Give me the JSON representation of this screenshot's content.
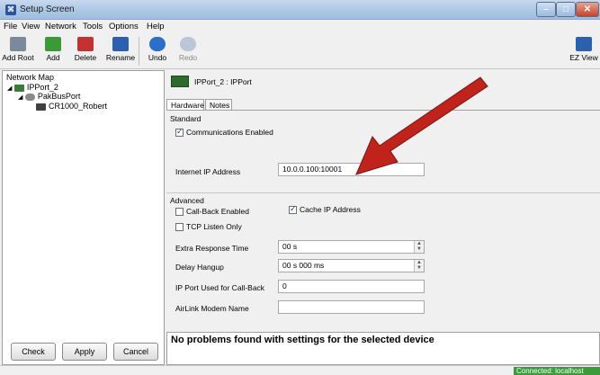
{
  "window": {
    "title": "Setup Screen"
  },
  "menu": [
    {
      "label": "File"
    },
    {
      "label": "View"
    },
    {
      "label": "Network"
    },
    {
      "label": "Tools"
    },
    {
      "label": "Options"
    },
    {
      "label": "Help"
    }
  ],
  "toolbar": {
    "add_root": "Add Root",
    "add": "Add",
    "delete": "Delete",
    "rename": "Rename",
    "undo": "Undo",
    "redo": "Redo",
    "ez_view": "EZ View"
  },
  "network_map": {
    "title": "Network Map",
    "nodes": [
      {
        "label": "IPPort_2"
      },
      {
        "label": "PakBusPort"
      },
      {
        "label": "CR1000_Robert"
      }
    ]
  },
  "left_buttons": {
    "check": "Check",
    "apply": "Apply",
    "cancel": "Cancel"
  },
  "device": {
    "header": "IPPort_2 : IPPort"
  },
  "tabs": [
    {
      "label": "Hardware",
      "active": true
    },
    {
      "label": "Notes",
      "active": false
    }
  ],
  "standard": {
    "section": "Standard",
    "comms_enabled_label": "Communications Enabled",
    "comms_enabled": true,
    "ip_label": "Internet IP Address",
    "ip_value": "10.0.0.100:10001"
  },
  "advanced": {
    "section": "Advanced",
    "callback_label": "Call-Back Enabled",
    "callback": false,
    "cache_ip_label": "Cache IP Address",
    "cache_ip": true,
    "tcp_listen_label": "TCP Listen Only",
    "tcp_listen": false,
    "extra_response_label": "Extra Response Time",
    "extra_response_value": "00 s",
    "delay_hangup_label": "Delay Hangup",
    "delay_hangup_value": "00 s 000 ms",
    "ip_port_callback_label": "IP Port Used for Call-Back",
    "ip_port_callback_value": "0",
    "airlink_label": "AirLink Modem Name",
    "airlink_value": ""
  },
  "message": "No problems found with settings for the selected device",
  "status": {
    "connection": "Connected: localhost"
  },
  "colors": {
    "arrow": "#c0231b",
    "status_ok": "#3b9a3b"
  }
}
